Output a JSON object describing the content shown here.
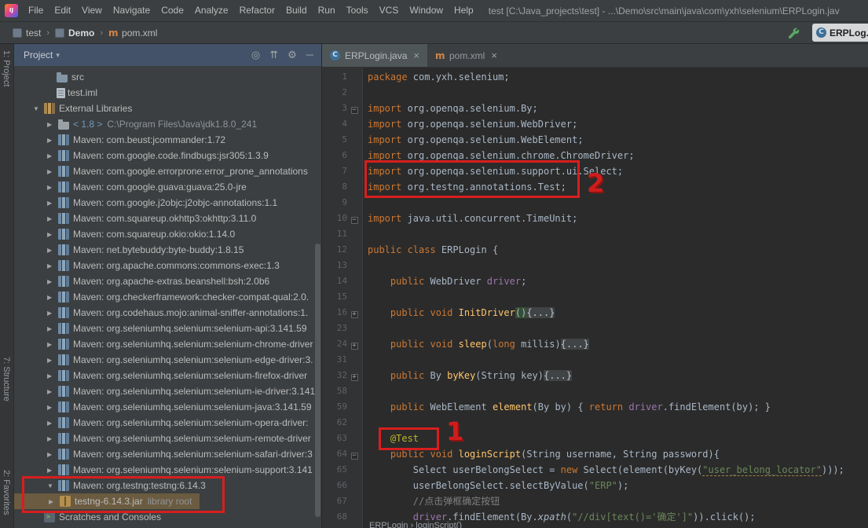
{
  "menubar": {
    "menus": [
      "File",
      "Edit",
      "View",
      "Navigate",
      "Code",
      "Analyze",
      "Refactor",
      "Build",
      "Run",
      "Tools",
      "VCS",
      "Window",
      "Help"
    ],
    "title": "test [C:\\Java_projects\\test] - ...\\Demo\\src\\main\\java\\com\\yxh\\selenium\\ERPLogin.jav"
  },
  "navbar": {
    "crumbs": [
      {
        "label": "test",
        "icon": "module",
        "bold": false
      },
      {
        "label": "Demo",
        "icon": "module",
        "bold": true
      },
      {
        "label": "pom.xml",
        "icon": "maven",
        "bold": false
      }
    ],
    "floating_tab": {
      "label": "ERPLog...",
      "icon": "class"
    }
  },
  "stripe": {
    "project": "1: Project",
    "structure": "7: Structure",
    "favorites": "2: Favorites"
  },
  "project_panel": {
    "title": "Project",
    "tree": [
      {
        "pad": 40,
        "arrow": "",
        "icon": "folder",
        "label": "src"
      },
      {
        "pad": 40,
        "arrow": "",
        "icon": "file",
        "label": "test.iml"
      },
      {
        "pad": 24,
        "arrow": "down",
        "icon": "extlib",
        "label": "External Libraries"
      },
      {
        "pad": 42,
        "arrow": "right",
        "icon": "jdk",
        "label": "< 1.8 >",
        "label_cls": "jdk-ver",
        "label2": "C:\\Program Files\\Java\\jdk1.8.0_241"
      },
      {
        "pad": 42,
        "arrow": "right",
        "icon": "lib",
        "label": "Maven: com.beust:jcommander:1.72"
      },
      {
        "pad": 42,
        "arrow": "right",
        "icon": "lib",
        "label": "Maven: com.google.code.findbugs:jsr305:1.3.9"
      },
      {
        "pad": 42,
        "arrow": "right",
        "icon": "lib",
        "label": "Maven: com.google.errorprone:error_prone_annotations"
      },
      {
        "pad": 42,
        "arrow": "right",
        "icon": "lib",
        "label": "Maven: com.google.guava:guava:25.0-jre"
      },
      {
        "pad": 42,
        "arrow": "right",
        "icon": "lib",
        "label": "Maven: com.google.j2objc:j2objc-annotations:1.1"
      },
      {
        "pad": 42,
        "arrow": "right",
        "icon": "lib",
        "label": "Maven: com.squareup.okhttp3:okhttp:3.11.0"
      },
      {
        "pad": 42,
        "arrow": "right",
        "icon": "lib",
        "label": "Maven: com.squareup.okio:okio:1.14.0"
      },
      {
        "pad": 42,
        "arrow": "right",
        "icon": "lib",
        "label": "Maven: net.bytebuddy:byte-buddy:1.8.15"
      },
      {
        "pad": 42,
        "arrow": "right",
        "icon": "lib",
        "label": "Maven: org.apache.commons:commons-exec:1.3"
      },
      {
        "pad": 42,
        "arrow": "right",
        "icon": "lib",
        "label": "Maven: org.apache-extras.beanshell:bsh:2.0b6"
      },
      {
        "pad": 42,
        "arrow": "right",
        "icon": "lib",
        "label": "Maven: org.checkerframework:checker-compat-qual:2.0."
      },
      {
        "pad": 42,
        "arrow": "right",
        "icon": "lib",
        "label": "Maven: org.codehaus.mojo:animal-sniffer-annotations:1."
      },
      {
        "pad": 42,
        "arrow": "right",
        "icon": "lib",
        "label": "Maven: org.seleniumhq.selenium:selenium-api:3.141.59"
      },
      {
        "pad": 42,
        "arrow": "right",
        "icon": "lib",
        "label": "Maven: org.seleniumhq.selenium:selenium-chrome-driver"
      },
      {
        "pad": 42,
        "arrow": "right",
        "icon": "lib",
        "label": "Maven: org.seleniumhq.selenium:selenium-edge-driver:3."
      },
      {
        "pad": 42,
        "arrow": "right",
        "icon": "lib",
        "label": "Maven: org.seleniumhq.selenium:selenium-firefox-driver"
      },
      {
        "pad": 42,
        "arrow": "right",
        "icon": "lib",
        "label": "Maven: org.seleniumhq.selenium:selenium-ie-driver:3.141"
      },
      {
        "pad": 42,
        "arrow": "right",
        "icon": "lib",
        "label": "Maven: org.seleniumhq.selenium:selenium-java:3.141.59"
      },
      {
        "pad": 42,
        "arrow": "right",
        "icon": "lib",
        "label": "Maven: org.seleniumhq.selenium:selenium-opera-driver:"
      },
      {
        "pad": 42,
        "arrow": "right",
        "icon": "lib",
        "label": "Maven: org.seleniumhq.selenium:selenium-remote-driver"
      },
      {
        "pad": 42,
        "arrow": "right",
        "icon": "lib",
        "label": "Maven: org.seleniumhq.selenium:selenium-safari-driver:3"
      },
      {
        "pad": 42,
        "arrow": "right",
        "icon": "lib",
        "label": "Maven: org.seleniumhq.selenium:selenium-support:3.141"
      },
      {
        "pad": 42,
        "arrow": "down",
        "icon": "lib",
        "label": "Maven: org.testng:testng:6.14.3"
      },
      {
        "pad": 44,
        "arrow": "right",
        "icon": "jar",
        "label": "testng-6.14.3.jar",
        "label2": "library root",
        "selected": true
      },
      {
        "pad": 24,
        "arrow": "",
        "icon": "scratch",
        "label": "Scratches and Consoles"
      }
    ]
  },
  "editor": {
    "tabs": [
      {
        "label": "ERPLogin.java",
        "icon": "class",
        "active": true
      },
      {
        "label": "pom.xml",
        "icon": "maven",
        "active": false
      }
    ],
    "breadcrumb": "ERPLogin › loginScript()",
    "lines": [
      {
        "n": 1,
        "seg": [
          [
            "k",
            "package "
          ],
          [
            "p",
            "com.yxh.selenium;"
          ]
        ]
      },
      {
        "n": 2,
        "seg": []
      },
      {
        "n": 3,
        "fold": "minus",
        "seg": [
          [
            "k",
            "import "
          ],
          [
            "p",
            "org.openqa.selenium.By;"
          ]
        ]
      },
      {
        "n": 4,
        "seg": [
          [
            "k",
            "import "
          ],
          [
            "p",
            "org.openqa.selenium.WebDriver;"
          ]
        ]
      },
      {
        "n": 5,
        "seg": [
          [
            "k",
            "import "
          ],
          [
            "p",
            "org.openqa.selenium.WebElement;"
          ]
        ]
      },
      {
        "n": 6,
        "seg": [
          [
            "k",
            "import "
          ],
          [
            "p",
            "org.openqa.selenium.chrome.ChromeDriver;"
          ]
        ]
      },
      {
        "n": 7,
        "seg": [
          [
            "k",
            "import "
          ],
          [
            "p",
            "org.openqa.selenium.support.ui.Select;"
          ]
        ]
      },
      {
        "n": 8,
        "seg": [
          [
            "k",
            "import "
          ],
          [
            "p",
            "org.testng.annotations.Test;"
          ]
        ]
      },
      {
        "n": 9,
        "seg": []
      },
      {
        "n": 10,
        "fold": "minus",
        "seg": [
          [
            "k",
            "import "
          ],
          [
            "p",
            "java.util.concurrent.TimeUnit;"
          ]
        ]
      },
      {
        "n": 11,
        "seg": []
      },
      {
        "n": 12,
        "seg": [
          [
            "k",
            "public class "
          ],
          [
            "p",
            "ERPLogin {"
          ]
        ]
      },
      {
        "n": 13,
        "seg": []
      },
      {
        "n": 14,
        "seg": [
          [
            "p",
            "    "
          ],
          [
            "k",
            "public "
          ],
          [
            "p",
            "WebDriver "
          ],
          [
            "f",
            "driver"
          ],
          [
            "p",
            ";"
          ]
        ]
      },
      {
        "n": 15,
        "seg": []
      },
      {
        "n": 16,
        "fold": "plus",
        "seg": [
          [
            "p",
            "    "
          ],
          [
            "k",
            "public void "
          ],
          [
            "m",
            "InitDriver"
          ],
          [
            "hl",
            "()"
          ],
          [
            "fd",
            "{...}"
          ]
        ]
      },
      {
        "n": 23,
        "seg": []
      },
      {
        "n": 24,
        "fold": "plus",
        "seg": [
          [
            "p",
            "    "
          ],
          [
            "k",
            "public void "
          ],
          [
            "m",
            "sleep"
          ],
          [
            "p",
            "("
          ],
          [
            "k",
            "long"
          ],
          [
            "p",
            " millis)"
          ],
          [
            "fd",
            "{...}"
          ]
        ]
      },
      {
        "n": 31,
        "seg": []
      },
      {
        "n": 32,
        "fold": "plus",
        "seg": [
          [
            "p",
            "    "
          ],
          [
            "k",
            "public "
          ],
          [
            "p",
            "By "
          ],
          [
            "m",
            "byKey"
          ],
          [
            "p",
            "(String key)"
          ],
          [
            "fd",
            "{...}"
          ]
        ]
      },
      {
        "n": 58,
        "seg": []
      },
      {
        "n": 59,
        "seg": [
          [
            "p",
            "    "
          ],
          [
            "k",
            "public "
          ],
          [
            "p",
            "WebElement "
          ],
          [
            "m",
            "element"
          ],
          [
            "p",
            "(By by) { "
          ],
          [
            "k",
            "return "
          ],
          [
            "f",
            "driver"
          ],
          [
            "p",
            ".findElement(by); }"
          ]
        ]
      },
      {
        "n": 62,
        "seg": []
      },
      {
        "n": 63,
        "seg": [
          [
            "p",
            "    "
          ],
          [
            "a",
            "@Test"
          ]
        ]
      },
      {
        "n": 64,
        "fold": "minus",
        "seg": [
          [
            "p",
            "    "
          ],
          [
            "k",
            "public void "
          ],
          [
            "m",
            "loginScript"
          ],
          [
            "p",
            "(String username, String password){"
          ]
        ]
      },
      {
        "n": 65,
        "seg": [
          [
            "p",
            "        Select userBelongSelect = "
          ],
          [
            "k",
            "new "
          ],
          [
            "p",
            "Select(element(byKey("
          ],
          [
            "su",
            "\"user_belong_locator\""
          ],
          [
            "p",
            ")));"
          ]
        ]
      },
      {
        "n": 66,
        "seg": [
          [
            "p",
            "        userBelongSelect.selectByValue("
          ],
          [
            "s",
            "\"ERP\""
          ],
          [
            "p",
            ");"
          ]
        ]
      },
      {
        "n": 67,
        "seg": [
          [
            "c",
            "        //点击弹框确定按钮"
          ]
        ]
      },
      {
        "n": 68,
        "seg": [
          [
            "p",
            "        "
          ],
          [
            "f",
            "driver"
          ],
          [
            "p",
            ".findElement(By."
          ],
          [
            "it",
            "xpath"
          ],
          [
            "p",
            "("
          ],
          [
            "s",
            "\"//div[text()='确定']\""
          ],
          [
            "p",
            ")).click();"
          ]
        ]
      }
    ]
  },
  "annotations": {
    "num1": "1",
    "num2": "2"
  },
  "colors": {
    "accent_red": "#d81e1e",
    "keyword": "#cc7832",
    "string": "#6a8759",
    "selection_tan": "#6b5b40",
    "panel_bg": "#3c3f41",
    "editor_bg": "#2b2b2b"
  }
}
